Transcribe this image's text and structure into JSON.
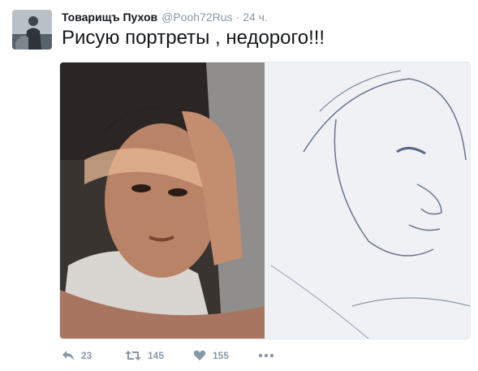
{
  "tweet": {
    "author_name": "Товарищъ Пухов",
    "author_handle": "@Pooh72Rus",
    "separator": "·",
    "time": "24 ч.",
    "text": "Рисую портреты , недорого!!!",
    "media_description_icon": "photo-collage",
    "actions": {
      "reply_count": "23",
      "retweet_count": "145",
      "like_count": "155"
    }
  },
  "icons": {
    "reply": "reply-icon",
    "retweet": "retweet-icon",
    "like": "heart-icon",
    "more": "more-icon"
  },
  "colors": {
    "text": "#14171a",
    "secondary": "#8899a6",
    "border": "#e1e8ed"
  }
}
